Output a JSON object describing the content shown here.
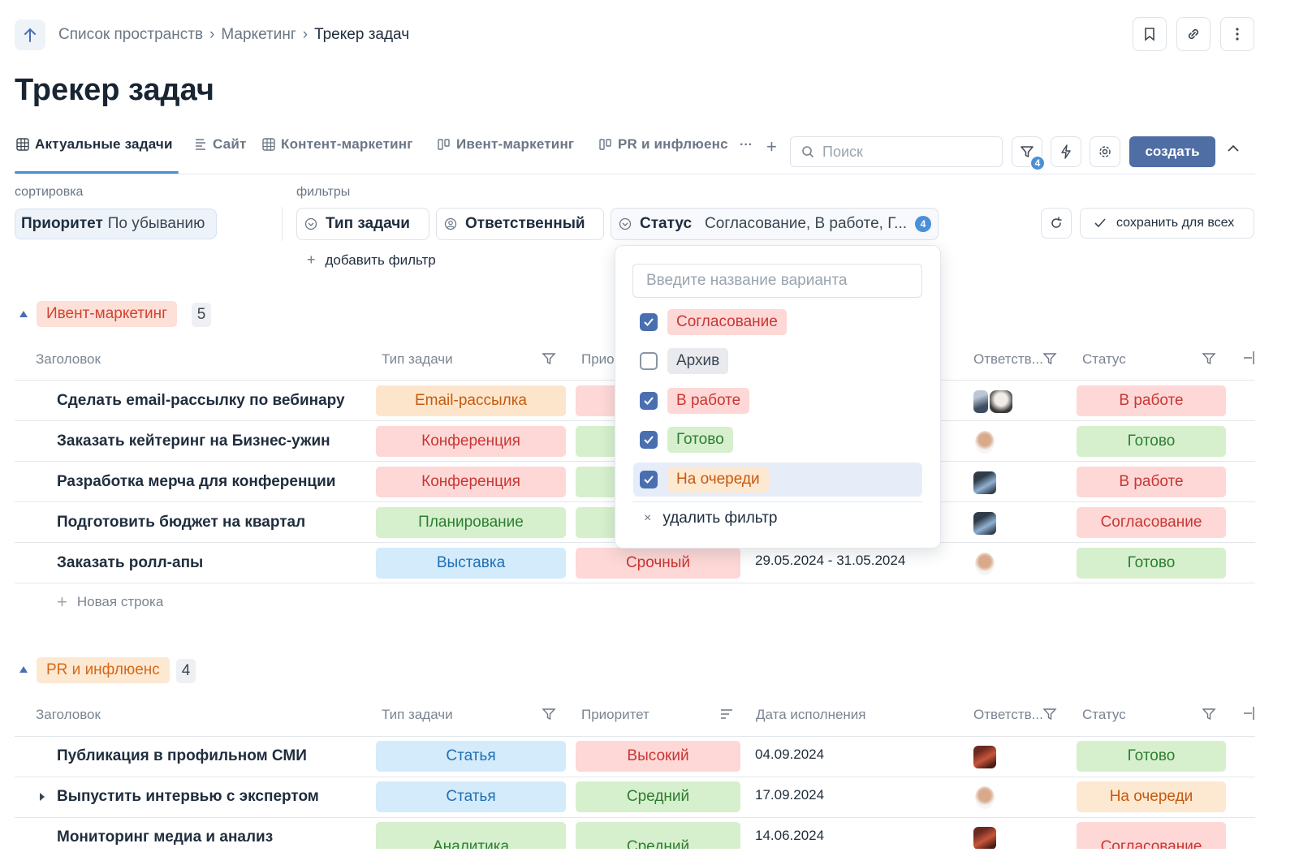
{
  "breadcrumb": [
    "Список пространств",
    "Маркетинг",
    "Трекер задач"
  ],
  "page_title": "Трекер задач",
  "tabs": [
    "Актуальные задачи",
    "Сайт",
    "Контент-маркетинг",
    "Ивент-маркетинг",
    "PR и инфлюенс"
  ],
  "more_tabs": "···",
  "add_tab": "+",
  "search": {
    "placeholder": "Поиск"
  },
  "filter_count": "4",
  "create_label": "создать",
  "sort": {
    "label": "сортировка",
    "field": "Приоритет",
    "direction": "По убыванию"
  },
  "filters": {
    "label": "фильтры",
    "type": "Тип задачи",
    "assignee": "Ответственный",
    "status": "Статус",
    "status_value": "Согласование, В работе, Г...",
    "status_count": "4",
    "add": "добавить фильтр",
    "save": "сохранить для всех"
  },
  "dropdown": {
    "placeholder": "Введите название варианта",
    "options": [
      {
        "label": "Согласование",
        "checked": true,
        "color": "#fdd8d6"
      },
      {
        "label": "Архив",
        "checked": false,
        "color": "#e8eaed"
      },
      {
        "label": "В работе",
        "checked": true,
        "color": "#fdd8d6"
      },
      {
        "label": "Готово",
        "checked": true,
        "color": "#d6f0cd"
      },
      {
        "label": "На очереди",
        "checked": true,
        "color": "#fde8d2"
      }
    ],
    "remove": "удалить фильтр"
  },
  "columns": {
    "title": "Заголовок",
    "type": "Тип задачи",
    "priority": "Приоритет",
    "priority_short": "Прио",
    "due": "Дата исполнения",
    "assignee": "Ответств...",
    "status": "Статус"
  },
  "groups": [
    {
      "name": "Ивент-маркетинг",
      "count": "5",
      "rows": [
        {
          "title": "Сделать email-рассылку по вебинару",
          "type": "Email-рассылка",
          "status": "В работе"
        },
        {
          "title": "Заказать кейтеринг на Бизнес-ужин",
          "type": "Конференция",
          "status": "Готово"
        },
        {
          "title": "Разработка мерча для конференции",
          "type": "Конференция",
          "status": "В работе"
        },
        {
          "title": "Подготовить бюджет на квартал",
          "type": "Планирование",
          "status": "Согласование"
        },
        {
          "title": "Заказать ролл-апы",
          "type": "Выставка",
          "priority": "Срочный",
          "due": "29.05.2024 - 31.05.2024",
          "status": "Готово"
        }
      ],
      "new_row": "Новая строка"
    },
    {
      "name": "PR и инфлюенс",
      "count": "4",
      "rows": [
        {
          "title": "Публикация в профильном СМИ",
          "type": "Статья",
          "priority": "Высокий",
          "due": "04.09.2024",
          "status": "Готово"
        },
        {
          "title": "Выпустить интервью с экспертом",
          "type": "Статья",
          "priority": "Средний",
          "due": "17.09.2024",
          "status": "На очереди"
        },
        {
          "title": "Мониторинг медиа и анализ",
          "type": "Аналитика",
          "priority": "Средний",
          "due": "14.06.2024",
          "status": "Согласование"
        }
      ]
    }
  ]
}
